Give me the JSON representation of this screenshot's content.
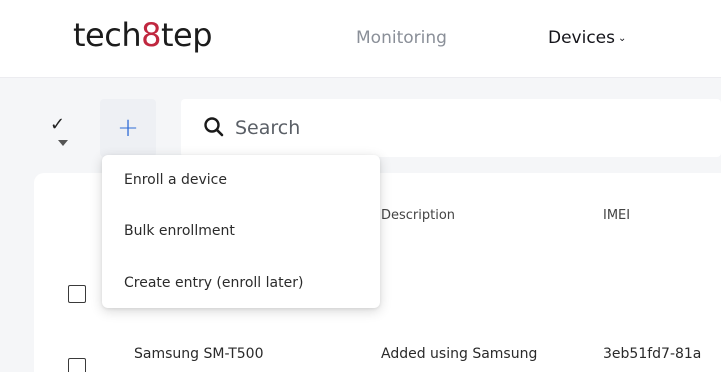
{
  "header": {
    "logo": {
      "part1": "tech",
      "accent": "8",
      "part2": "tep"
    },
    "nav": [
      {
        "label": "Monitoring"
      },
      {
        "label": "Devices",
        "chevron": "chevron-down-icon"
      }
    ]
  },
  "toolbar": {
    "select_icon": "checkmark-icon",
    "add_icon": "plus-icon",
    "search": {
      "placeholder": "Search",
      "value": ""
    }
  },
  "dropdown_menu": {
    "items": [
      {
        "label": "Enroll a device"
      },
      {
        "label": "Bulk enrollment"
      },
      {
        "label": "Create entry (enroll later)"
      }
    ]
  },
  "table": {
    "columns": [
      "Description",
      "IMEI"
    ],
    "rows": [
      {
        "name": "",
        "description": "",
        "imei": ""
      },
      {
        "name": "Samsung SM-T500",
        "description": "Added using Samsung",
        "imei": "3eb51fd7-81a"
      }
    ]
  },
  "colors": {
    "accent_red": "#c0273f",
    "accent_blue": "#2f6bd6",
    "background": "#f5f6f8"
  }
}
